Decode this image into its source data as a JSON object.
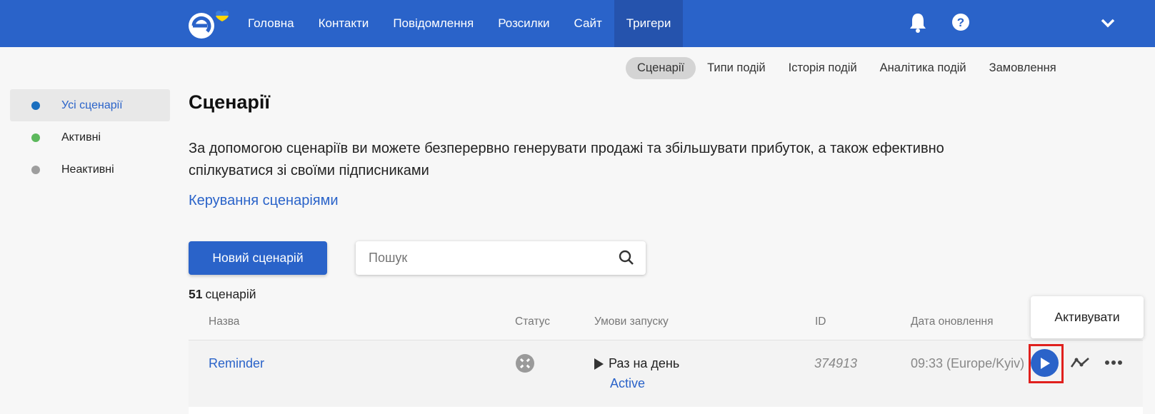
{
  "nav": {
    "items": [
      {
        "label": "Головна"
      },
      {
        "label": "Контакти"
      },
      {
        "label": "Повідомлення"
      },
      {
        "label": "Розсилки"
      },
      {
        "label": "Сайт"
      },
      {
        "label": "Тригери"
      }
    ],
    "active_index": 5,
    "bg_color": "#2a63c9"
  },
  "subnav": {
    "items": [
      {
        "label": "Сценарії"
      },
      {
        "label": "Типи подій"
      },
      {
        "label": "Історія подій"
      },
      {
        "label": "Аналітика подій"
      },
      {
        "label": "Замовлення"
      }
    ],
    "active_index": 0
  },
  "sidebar": {
    "items": [
      {
        "label": "Усі сценарії",
        "dot_color": "#1a6fbf"
      },
      {
        "label": "Активні",
        "dot_color": "#5cb85c"
      },
      {
        "label": "Неактивні",
        "dot_color": "#9e9e9e"
      }
    ]
  },
  "page": {
    "title": "Сценарії",
    "description": "За допомогою сценаріїв ви можете безперервно генерувати продажі та збільшувати прибуток, а також ефективно спілкуватися зі своїми підписниками",
    "manage_link": "Керування сценаріями",
    "new_button": "Новий сценарій",
    "search_placeholder": "Пошук",
    "count_number": "51",
    "count_label": "сценарій"
  },
  "table": {
    "headers": {
      "name": "Назва",
      "status": "Статус",
      "conditions": "Умови запуску",
      "id": "ID",
      "updated": "Дата оновлення"
    },
    "rows": [
      {
        "name": "Reminder",
        "condition": "Раз на день",
        "condition_status": "Active",
        "id": "374913",
        "updated": "09:33 (Europe/Kyiv)"
      }
    ]
  },
  "tooltip": {
    "label": "Активувати"
  }
}
